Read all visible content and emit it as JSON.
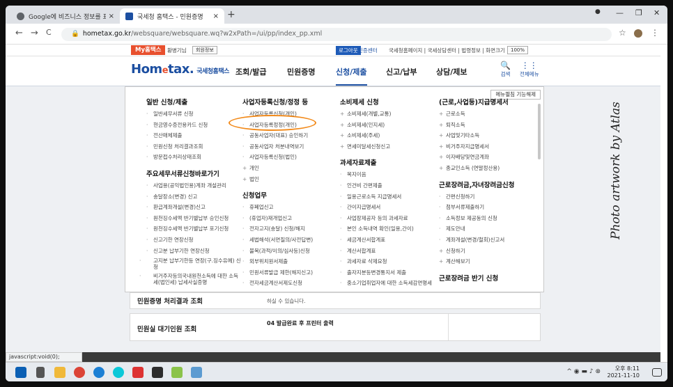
{
  "browser": {
    "tabs": [
      {
        "title": "Google에 비즈니스 정보를 표시",
        "favicon_color": "#5f6368",
        "active": false
      },
      {
        "title": "국세청 홈택스 - 민원증명",
        "favicon_color": "#1c4fa1",
        "active": true
      }
    ],
    "new_tab": "+",
    "close_glyph": "×",
    "window_controls": [
      "—",
      "❐",
      "✕"
    ],
    "address": {
      "host": "hometax.go.kr",
      "path": "/websquare/websquare.wq?w2xPath=/ui/pp/index_pp.xml"
    },
    "nav": {
      "back": "←",
      "forward": "→",
      "reload": "C"
    },
    "right_icons": [
      "☆",
      "⋮"
    ]
  },
  "topstrip": {
    "my_home": "My홈택스",
    "user": "황병기님",
    "user_info": "회원정보",
    "logout": "로그아웃",
    "cert_center": "인증센터",
    "links": "국세청홈페이지 | 국세상담센터 | 법령정보 | 화면크기",
    "zoom": "100%"
  },
  "gnb": {
    "logo_main": "Hom",
    "logo_e": "e",
    "logo_rest": "tax.",
    "logo_sub": "국세청홈택스",
    "menus": [
      "조회/발급",
      "민원증명",
      "신청/제출",
      "신고/납부",
      "상담/제보"
    ],
    "search": "검색",
    "all_menu": "전체메뉴"
  },
  "mega": {
    "close": "메뉴펼침 기능해제",
    "col1_title": "일반 신청/제출",
    "col1": [
      "일반세무서류 신청",
      "현금영수증전용카드 신청",
      "전산매체제출",
      "민원신청 처리결과조회",
      "방문접수처리상태조회"
    ],
    "col1b_title": "주요세무서류신청바로가기",
    "col1b": [
      "사업용(공익법인용)계좌 개설관리",
      "송달장소(변경) 신고",
      "환급계좌개설(변경)신고",
      "원천징수세액 반기별납부 승인신청",
      "원천징수세액 반기별납부 포기신청",
      "신고기한 연장신청",
      "신고분 납부기한 연장신청",
      "고지분 납부기한등 연장(구.징수유예) 신청",
      "비거주자등의국내원천소득에 대한 소득세(법인세) 납세사실증명"
    ],
    "col2_title": "사업자등록신청/정정 등",
    "col2": [
      "사업자등록신청(개인)",
      "사업자등록정정(개인)",
      "공동사업자(대표) 승인하기",
      "공동사업자 처분내역보기",
      "사업자등록신청(법인)"
    ],
    "col2_plus": [
      "개인",
      "법인"
    ],
    "col2b_title": "신청업무",
    "col2b": [
      "휴폐업신고",
      "(휴업자)재개업신고",
      "전자고지(송달) 신청/해지",
      "세법해석(서면질의/사전답변)",
      "불복(과적/이의/심사등)신청",
      "외부위치원서제출",
      "민원서류발급 제한(해지신고)",
      "전자세금계산서제도신청"
    ],
    "col3_title": "소비제세 신청",
    "col3": [
      "소비제세(개별,교통)",
      "소비제세(인지세)",
      "소비제세(주세)",
      "면세미달세신청신고"
    ],
    "col3b_title": "과세자료제출",
    "col3b": [
      "복지이음",
      "인건비 간편제출",
      "일용근로소득 지급명세서",
      "간이지급명세서",
      "사업장제공자 등의 과세자료",
      "본인 소득내역 확인(일용,간이)",
      "세금계산서합계표",
      "계산서합계표",
      "과세자료 삭제요청",
      "출자지분등변경통지서 제출",
      "중소기업취업자에 대한 소득세감면명세"
    ],
    "col4_title": "(근로,사업등)지급명세서",
    "col4": [
      "근로소득",
      "퇴직소득",
      "사업및기타소득",
      "비거주자지급명세서",
      "이자배당및연금계좌",
      "종교인소득 (연말정산용)"
    ],
    "col4b_title": "근로장려금,자녀장려금신청",
    "col4b": [
      "간편신청하기",
      "첨부서류제출하기",
      "소득정보 제공동의 신청",
      "제도안내",
      "계좌개설(변경/철회)신고서",
      "신청하기",
      "계산해보기"
    ],
    "col4c_title": "근로장려금 반기 신청"
  },
  "lower": {
    "row1_left": "민원증명 처리결과 조회",
    "row1_mid": "하실 수 있습니다.",
    "row2_left": "민원실 대기인원 조회",
    "row2_mid": "04 발급완료 후 프린터 출력"
  },
  "watermark": "Photo artwork by Atlas",
  "status_url": "javascript:void(0);",
  "taskbar": {
    "time": "오후 8:11",
    "date": "2021-11-10"
  }
}
